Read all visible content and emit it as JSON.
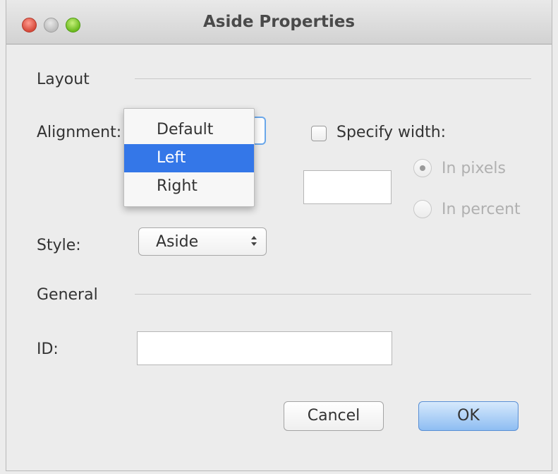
{
  "window": {
    "title": "Aside Properties"
  },
  "layout": {
    "section_label": "Layout",
    "alignment_label": "Alignment:",
    "alignment_menu": {
      "options": [
        "Default",
        "Left",
        "Right"
      ],
      "selected": "Left"
    },
    "specify_width_label": "Specify width:",
    "specify_width_checked": false,
    "width_value": "",
    "unit_pixels_label": "In pixels",
    "unit_percent_label": "In percent",
    "unit_selected": "In pixels",
    "style_label": "Style:",
    "style_value": "Aside"
  },
  "general": {
    "section_label": "General",
    "id_label": "ID:",
    "id_value": ""
  },
  "buttons": {
    "cancel_label": "Cancel",
    "ok_label": "OK"
  },
  "colors": {
    "selection": "#3477e8",
    "ok_button": "#8ebdf2",
    "focus_ring": "#6aa7ea"
  }
}
